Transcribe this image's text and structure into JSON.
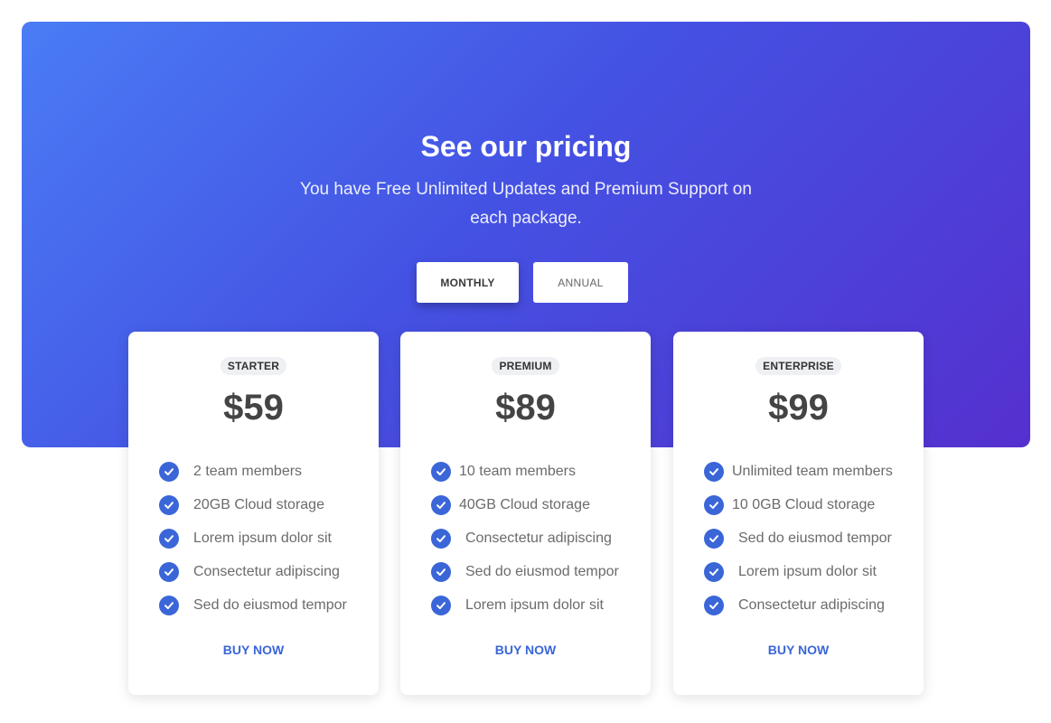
{
  "hero": {
    "title": "See our pricing",
    "subtitle": "You have Free Unlimited Updates and Premium Support on each package.",
    "gradient_colors": [
      "#4a7cf5",
      "#4452e3",
      "#5530cf"
    ]
  },
  "billing_toggle": {
    "selected": "MONTHLY",
    "options": [
      {
        "label": "MONTHLY"
      },
      {
        "label": "ANNUAL"
      }
    ]
  },
  "accent_color": "#3a66d8",
  "plans": [
    {
      "name": "STARTER",
      "price": "$59",
      "features": [
        "2 team members",
        "20GB Cloud storage",
        "Lorem ipsum dolor sit",
        "Consectetur adipiscing",
        "Sed do eiusmod tempor"
      ],
      "cta": "BUY NOW"
    },
    {
      "name": "PREMIUM",
      "price": "$89",
      "features": [
        "10 team members",
        "40GB Cloud storage",
        "Consectetur adipiscing",
        "Sed do eiusmod tempor",
        "Lorem ipsum dolor sit"
      ],
      "cta": "BUY NOW"
    },
    {
      "name": "ENTERPRISE",
      "price": "$99",
      "features": [
        "Unlimited team members",
        "10 0GB Cloud storage",
        "Sed do eiusmod tempor",
        "Lorem ipsum dolor sit",
        "Consectetur adipiscing"
      ],
      "cta": "BUY NOW"
    }
  ],
  "icons": {
    "feature_check": "check-circle-icon"
  }
}
